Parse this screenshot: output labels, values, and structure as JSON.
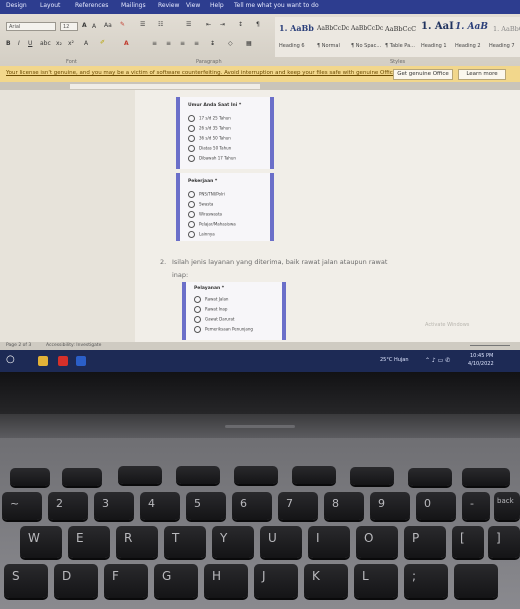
{
  "menubar": {
    "items": [
      "Design",
      "Layout",
      "References",
      "Mailings",
      "Review",
      "View",
      "Help",
      "Tell me what you want to do"
    ]
  },
  "ribbon": {
    "font_name": "Arial",
    "font_size": "12",
    "group_font": "Font",
    "group_paragraph": "Paragraph",
    "group_styles": "Styles",
    "styles": [
      {
        "preview": "1. AaBb",
        "label": "Heading 6"
      },
      {
        "preview": "AaBbCcDc",
        "label": "¶ Normal"
      },
      {
        "preview": "AaBbCcDc",
        "label": "¶ No Spac..."
      },
      {
        "preview": "AaBbCcC",
        "label": "¶ Table Pa..."
      },
      {
        "preview": "1. AaI",
        "label": "Heading 1"
      },
      {
        "preview": "1. AaB",
        "label": "Heading 2"
      },
      {
        "preview": "1. AaBbC",
        "label": "Heading 7"
      }
    ]
  },
  "license_bar": {
    "message": "Your license isn't genuine, and you may be a victim of software counterfeiting. Avoid interruption and keep your files safe with genuine Office today.",
    "get_genuine": "Get genuine Office",
    "learn_more": "Learn more"
  },
  "document": {
    "card1_title": "Umur Anda Saat Ini *",
    "card1_options": [
      "17 s/d 25 Tahun",
      "26 s/d 35 Tahun",
      "36 s/d 50 Tahun",
      "Diatas 50 Tahun",
      "Dibawah 17 Tahun"
    ],
    "card2_title": "Pekerjaan *",
    "card2_options": [
      "PNS/TNI/Polri",
      "Swasta",
      "Wiraswasta",
      "Pelajar/Mahasiswa",
      "Lainnya"
    ],
    "question_number": "2.",
    "question_line1": "Isilah jenis layanan yang diterima, baik rawat jalan ataupun rawat",
    "question_line2": "inap:",
    "card3_title": "Pelayanan *",
    "card3_options": [
      "Rawat Jalan",
      "Rawat Inap",
      "Gawat Darurat",
      "Pemeriksaan Penunjang"
    ],
    "watermark": "Activate Windows"
  },
  "statusbar": {
    "page": "Page 2 of 3",
    "accessibility": "Accessibility: Investigate"
  },
  "taskbar": {
    "weather": "25°C Hujan",
    "time": "10:45 PM",
    "date": "4/10/2022"
  },
  "keyboard": {
    "number_row": [
      "~",
      "2",
      "3",
      "4",
      "5",
      "6",
      "7",
      "8",
      "9",
      "0",
      "-",
      "=",
      "back"
    ],
    "qwerty_row": [
      "W",
      "E",
      "R",
      "T",
      "Y",
      "U",
      "I",
      "O",
      "P",
      "[",
      "]"
    ],
    "home_row": [
      "S",
      "D",
      "F",
      "G",
      "H",
      "J",
      "K",
      "L",
      ";"
    ]
  }
}
